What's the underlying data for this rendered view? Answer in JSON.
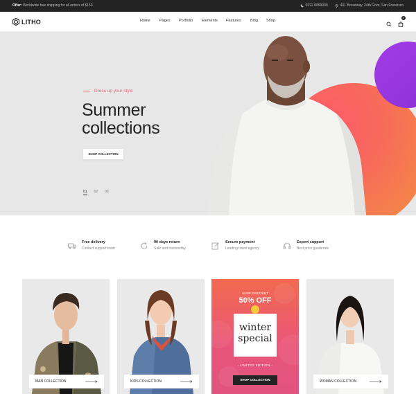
{
  "topbar": {
    "offer_label": "Offer:",
    "offer_text": "Worldwide free shipping for all orders of $150.",
    "phone": "0222 8899900",
    "address": "401 Broadway, 24th Floor, San Francisco"
  },
  "header": {
    "logo": "LITHO",
    "nav": [
      "Home",
      "Pages",
      "Portfolio",
      "Elements",
      "Features",
      "Blog",
      "Shop"
    ],
    "cart_count": "0"
  },
  "hero": {
    "tagline": "Dress up your style",
    "title_line1": "Summer",
    "title_line2": "collections",
    "button": "SHOP COLLECTION",
    "slides": [
      "01",
      "02",
      "03"
    ]
  },
  "features": [
    {
      "title": "Free delivery",
      "subtitle": "Contact support team",
      "icon": "truck-icon"
    },
    {
      "title": "90 days return",
      "subtitle": "Safe and trustworthy",
      "icon": "refresh-icon"
    },
    {
      "title": "Secure payment",
      "subtitle": "Leading travel agency",
      "icon": "edit-check-icon"
    },
    {
      "title": "Expert support",
      "subtitle": "Best price guarantee",
      "icon": "headphones-icon"
    }
  ],
  "collections": {
    "man": "MAN COLLECTION",
    "kids": "KIDS COLLECTION",
    "woman": "WOMAN COLLECTION"
  },
  "promo": {
    "small": "HUGE DISCOUNT",
    "big": "50% OFF",
    "card_line1": "winter",
    "card_line2": "special",
    "limited": "- LIMITED EDITION -",
    "button": "SHOP COLLECTION"
  },
  "colors": {
    "accent_pink": "#f25e78",
    "dark": "#232323",
    "orange_blob": "#f76a5a",
    "purple_blob": "#a33de6"
  }
}
